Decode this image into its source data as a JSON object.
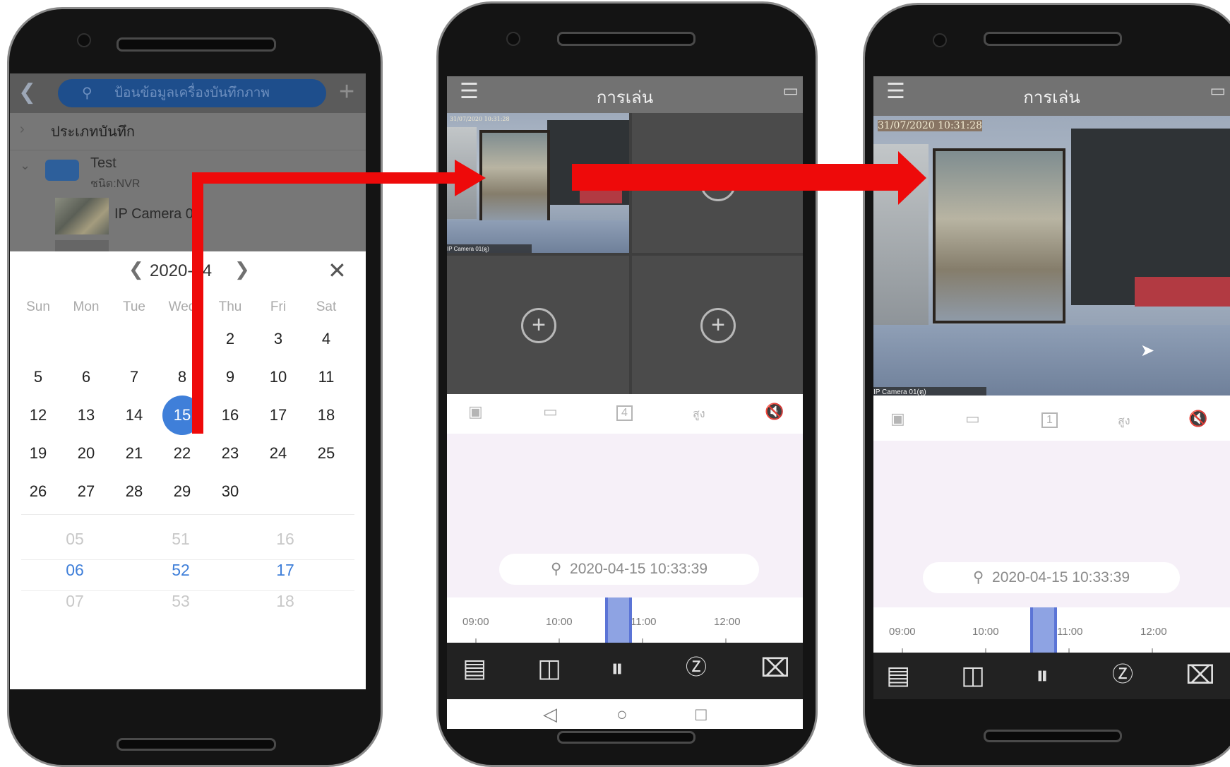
{
  "screen1": {
    "search_placeholder": "ป้อนข้อมูลเครื่องบันทึกภาพ",
    "category_label": "ประเภทบันทึก",
    "device_name": "Test",
    "device_type": "ชนิด:NVR",
    "camera_name": "IP Camera 01",
    "calendar": {
      "month_label": "2020-04",
      "weekdays": [
        "Sun",
        "Mon",
        "Tue",
        "Wed",
        "Thu",
        "Fri",
        "Sat"
      ],
      "weeks": [
        [
          "",
          "",
          "",
          "",
          "2",
          "3",
          "4"
        ],
        [
          "5",
          "6",
          "7",
          "8",
          "9",
          "10",
          "11"
        ],
        [
          "12",
          "13",
          "14",
          "15",
          "16",
          "17",
          "18"
        ],
        [
          "19",
          "20",
          "21",
          "22",
          "23",
          "24",
          "25"
        ],
        [
          "26",
          "27",
          "28",
          "29",
          "30",
          "",
          ""
        ]
      ],
      "selected_day": "15"
    },
    "time_picker": {
      "hours": [
        "05",
        "06",
        "07"
      ],
      "minutes": [
        "51",
        "52",
        "53"
      ],
      "seconds": [
        "16",
        "17",
        "18"
      ],
      "selected_index": 1
    }
  },
  "screen2": {
    "title": "การเล่น",
    "video_timestamp": "31/07/2020 10:31:28",
    "camera_label": "IP Camera 01(ดู)",
    "grid_layout": "4",
    "quality_label": "สูง",
    "search_datetime": "2020-04-15 10:33:39",
    "timeline_labels": [
      "09:00",
      "10:00",
      "11:00",
      "12:00"
    ]
  },
  "screen3": {
    "title": "การเล่น",
    "video_timestamp": "31/07/2020 10:31:28",
    "camera_label": "IP Camera 01(ดู)",
    "grid_layout": "1",
    "quality_label": "สูง",
    "search_datetime": "2020-04-15 10:33:39",
    "timeline_labels": [
      "09:00",
      "10:00",
      "11:00",
      "12:00"
    ]
  },
  "colors": {
    "arrow": "#ee0a0a",
    "selected_day": "#3f7fd9",
    "time_selected": "#3f7fd9",
    "recording_bar": "#8ea3e3"
  }
}
